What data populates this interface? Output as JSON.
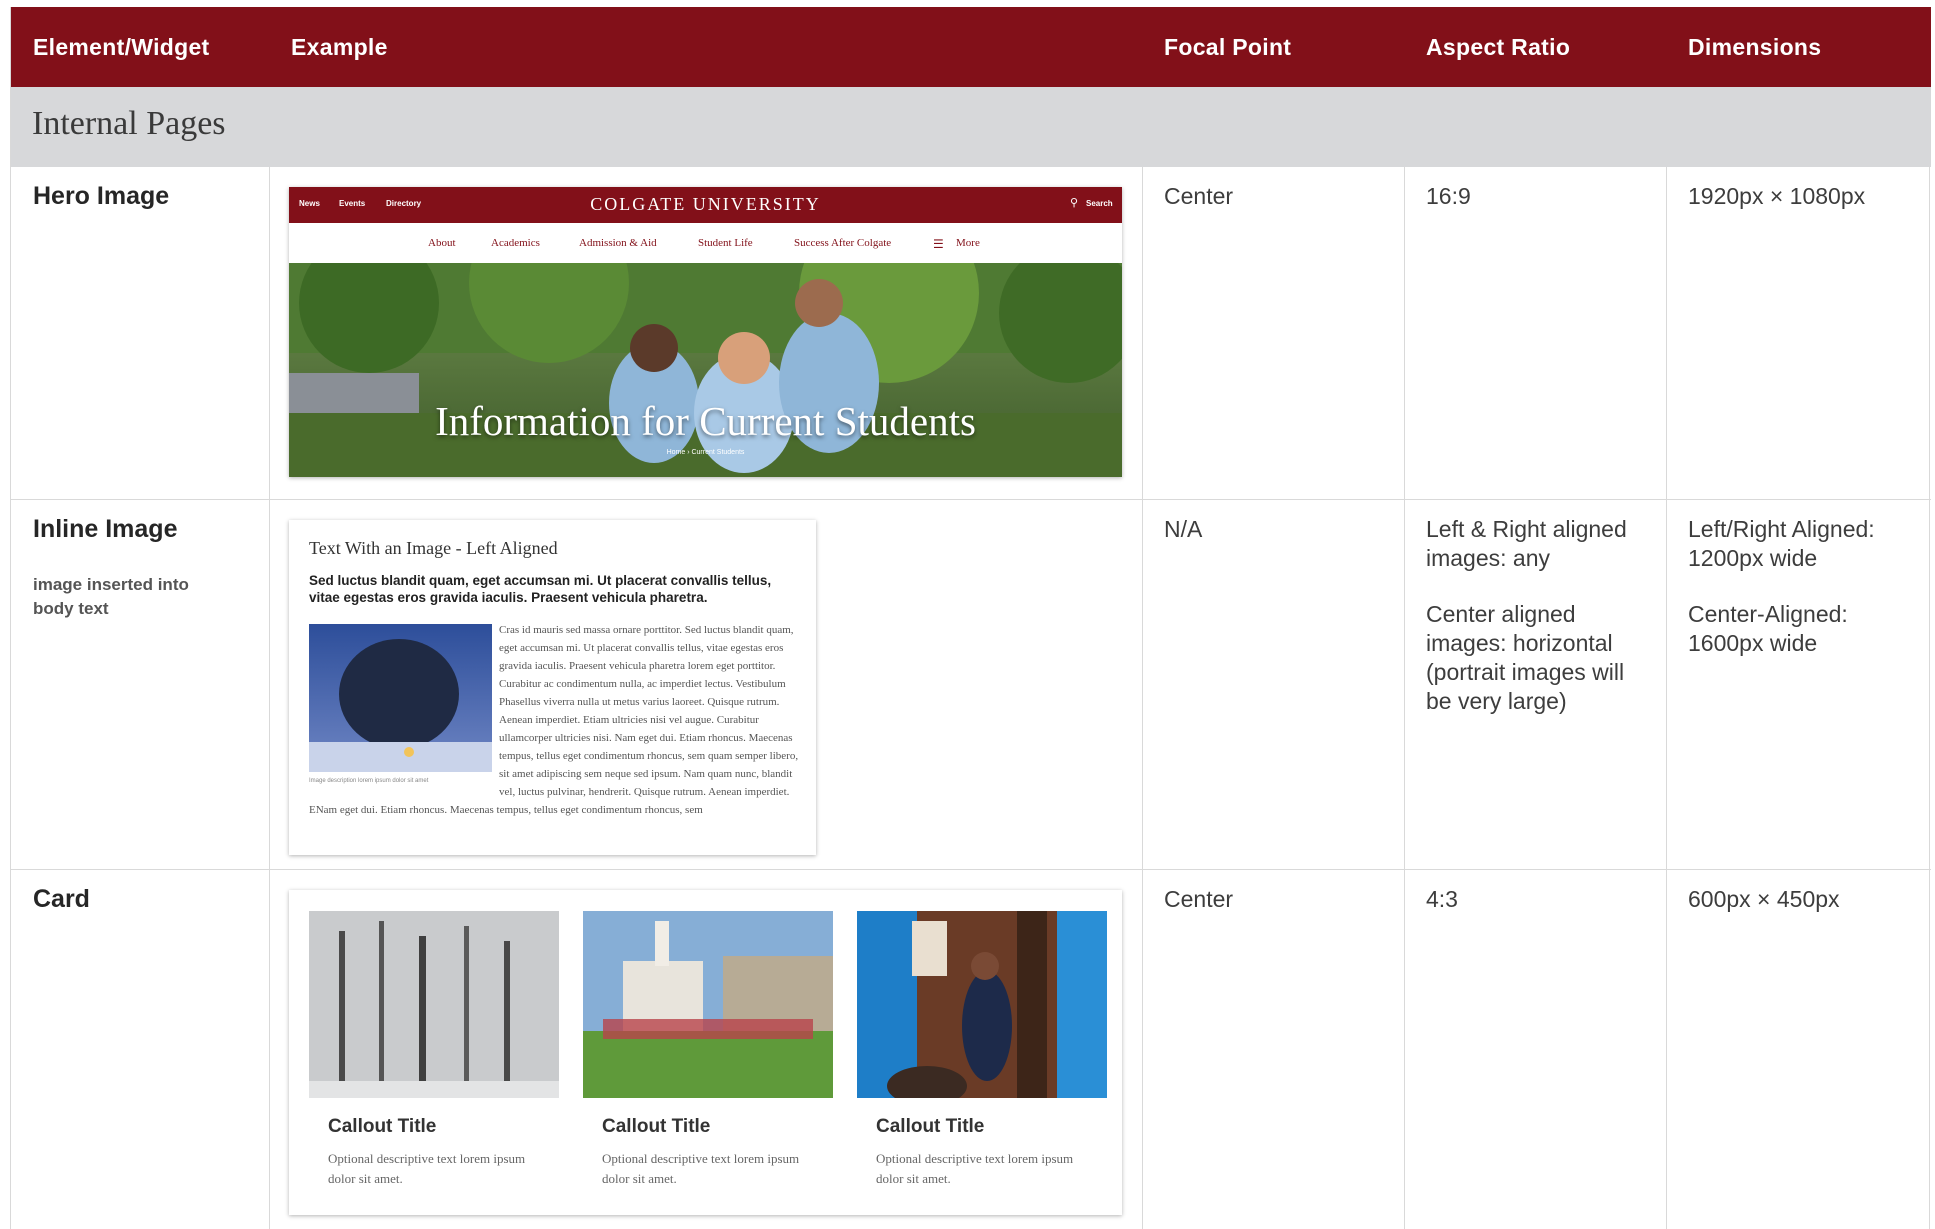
{
  "header": {
    "col_element": "Element/Widget",
    "col_example": "Example",
    "col_focal": "Focal Point",
    "col_aspect": "Aspect Ratio",
    "col_dimensions": "Dimensions"
  },
  "section": {
    "title": "Internal Pages"
  },
  "colors": {
    "brand": "#821019",
    "section_bg": "#d7d8da",
    "border": "#d9d9d9"
  },
  "rows": [
    {
      "title": "Hero Image",
      "focal": "Center",
      "aspect": "16:9",
      "dimensions": "1920px × 1080px",
      "example": {
        "util_links": [
          "News",
          "Events",
          "Directory"
        ],
        "brand": "COLGATE UNIVERSITY",
        "search": "Search",
        "nav": [
          "About",
          "Academics",
          "Admission & Aid",
          "Student Life",
          "Success After Colgate",
          "More"
        ],
        "heading": "Information for Current Students",
        "breadcrumb": "Home  ›  Current Students"
      }
    },
    {
      "title": "Inline Image",
      "subtitle": "image inserted into body text",
      "focal": "N/A",
      "aspect_1": "Left & Right aligned images: any",
      "aspect_2": "Center aligned images: horizontal (portrait images will be very large)",
      "dimensions_1": "Left/Right Aligned: 1200px wide",
      "dimensions_2": "Center-Aligned: 1600px wide",
      "example": {
        "heading": "Text With an Image - Left Aligned",
        "lead": "Sed luctus blandit quam, eget accumsan mi. Ut placerat convallis tellus, vitae egestas eros gravida iaculis. Praesent vehicula pharetra.",
        "caption": "Image description lorem ipsum dolor sit amet",
        "body": "Cras id mauris sed massa ornare porttitor. Sed luctus blandit quam, eget accumsan mi. Ut placerat convallis tellus, vitae egestas eros gravida iaculis. Praesent vehicula pharetra lorem eget porttitor. Curabitur ac condimentum nulla, ac imperdiet lectus. Vestibulum Phasellus viverra nulla ut metus varius laoreet. Quisque rutrum. Aenean imperdiet. Etiam ultricies nisi vel augue. Curabitur ullamcorper ultricies nisi. Nam eget dui. Etiam rhoncus. Maecenas tempus, tellus eget condimentum rhoncus, sem quam semper libero, sit amet adipiscing sem neque sed ipsum. Nam quam nunc, blandit vel, luctus pulvinar, hendrerit. Quisque rutrum. Aenean imperdiet. ENam eget dui. Etiam rhoncus. Maecenas tempus, tellus eget condimentum rhoncus, sem"
      }
    },
    {
      "title": "Card",
      "focal": "Center",
      "aspect": "4:3",
      "dimensions": "600px × 450px",
      "example": {
        "cards": [
          {
            "title": "Callout Title",
            "desc": "Optional descriptive text lorem ipsum dolor sit amet."
          },
          {
            "title": "Callout Title",
            "desc": "Optional descriptive text lorem ipsum dolor sit amet."
          },
          {
            "title": "Callout Title",
            "desc": "Optional descriptive text lorem ipsum dolor sit amet."
          }
        ]
      }
    }
  ]
}
